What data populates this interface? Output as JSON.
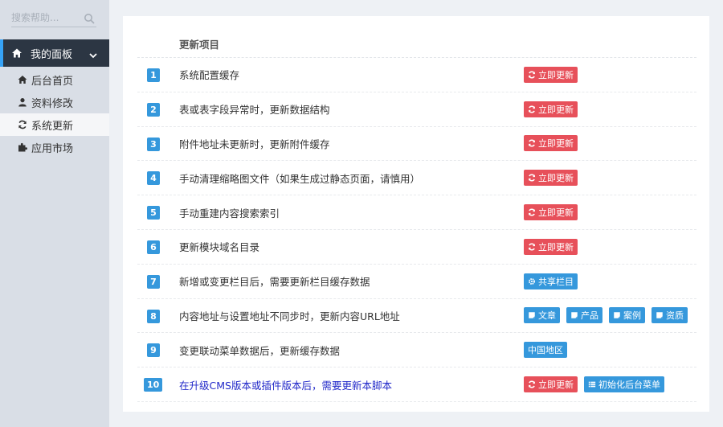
{
  "sidebar": {
    "search_placeholder": "搜索帮助...",
    "group_label": "我的面板",
    "items": [
      {
        "label": "后台首页",
        "icon": "home-icon"
      },
      {
        "label": "资料修改",
        "icon": "user-icon"
      },
      {
        "label": "系统更新",
        "icon": "refresh-icon",
        "active": true
      },
      {
        "label": "应用市场",
        "icon": "puzzle-icon"
      }
    ]
  },
  "table": {
    "header": "更新项目",
    "rows": [
      {
        "num": "1",
        "text": "系统配置缓存",
        "actions": [
          "立即更新"
        ]
      },
      {
        "num": "2",
        "text": "表或表字段异常时，更新数据结构",
        "actions": [
          "立即更新"
        ]
      },
      {
        "num": "3",
        "text": "附件地址未更新时，更新附件缓存",
        "actions": [
          "立即更新"
        ]
      },
      {
        "num": "4",
        "text": "手动清理缩略图文件（如果生成过静态页面，请慎用）",
        "actions": [
          "立即更新"
        ]
      },
      {
        "num": "5",
        "text": "手动重建内容搜索索引",
        "actions": [
          "立即更新"
        ]
      },
      {
        "num": "6",
        "text": "更新模块域名目录",
        "actions": [
          "立即更新"
        ]
      },
      {
        "num": "7",
        "text": "新增或变更栏目后，需要更新栏目缓存数据",
        "actions": [
          "共享栏目"
        ]
      },
      {
        "num": "8",
        "text": "内容地址与设置地址不同步时，更新内容URL地址",
        "actions": [
          "文章",
          "产品",
          "案例",
          "资质"
        ]
      },
      {
        "num": "9",
        "text": "变更联动菜单数据后，更新缓存数据",
        "actions": [
          "中国地区"
        ]
      },
      {
        "num": "10",
        "text": "在升级CMS版本或插件版本后，需要更新本脚本",
        "actions": [
          "立即更新",
          "初始化后台菜单"
        ]
      }
    ]
  },
  "colors": {
    "sidebar_bg": "#d9dee6",
    "menu_active_bg": "#2c3643",
    "accent_blue": "#3598dc",
    "danger_red": "#e7505a",
    "link_blue": "#2229c9"
  }
}
